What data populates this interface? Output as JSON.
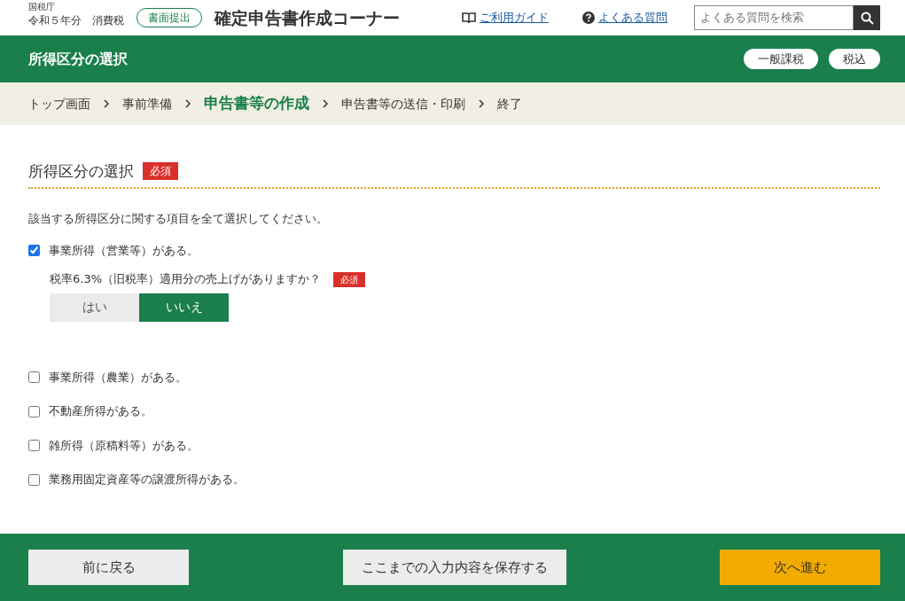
{
  "header": {
    "agency": "国税庁",
    "year_tax": "令和５年分　消費税",
    "submit_badge": "書面提出",
    "title": "確定申告書作成コーナー",
    "guide_link": "ご利用ガイド",
    "faq_link": "よくある質問",
    "search": {
      "placeholder": "よくある質問を検索"
    }
  },
  "title_bar": {
    "title": "所得区分の選択",
    "tags": [
      "一般課税",
      "税込"
    ]
  },
  "breadcrumb": [
    {
      "label": "トップ画面",
      "selected": false
    },
    {
      "label": "事前準備",
      "selected": false
    },
    {
      "label": "申告書等の作成",
      "selected": true
    },
    {
      "label": "申告書等の送信・印刷",
      "selected": false
    },
    {
      "label": "終了",
      "selected": false
    }
  ],
  "section": {
    "heading": "所得区分の選択",
    "required": "必須",
    "instruction": "該当する所得区分に関する項目を全て選択してください。",
    "items": [
      {
        "label": "事業所得（営業等）がある。",
        "checked": true,
        "question": {
          "label": "税率6.3%（旧税率）適用分の売上げがありますか？",
          "required": "必須",
          "options": [
            {
              "label": "はい",
              "selected": false
            },
            {
              "label": "いいえ",
              "selected": true
            }
          ]
        }
      },
      {
        "label": "事業所得（農業）がある。",
        "checked": false
      },
      {
        "label": "不動産所得がある。",
        "checked": false
      },
      {
        "label": "雑所得（原稿料等）がある。",
        "checked": false
      },
      {
        "label": "業務用固定資産等の譲渡所得がある。",
        "checked": false
      }
    ]
  },
  "footer": {
    "back": "前に戻る",
    "save": "ここまでの入力内容を保存する",
    "next": "次へ進む"
  }
}
